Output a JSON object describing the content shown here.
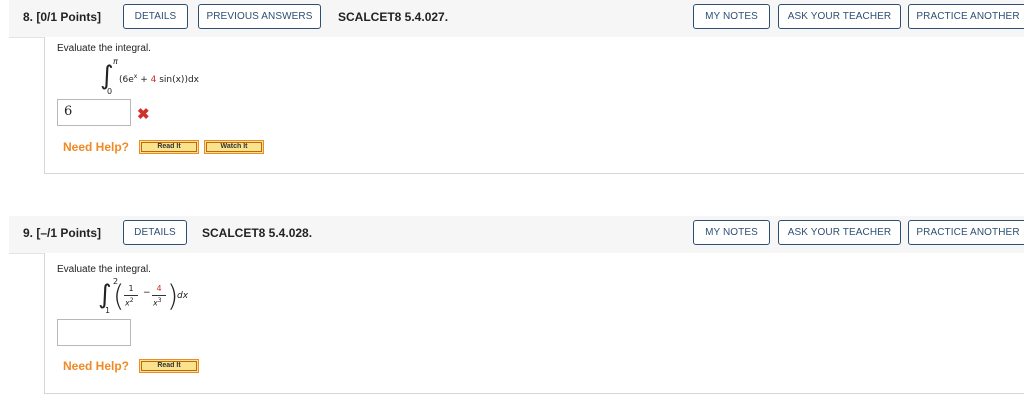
{
  "questions": [
    {
      "number_label": "8. [0/1 Points]",
      "buttons": {
        "details": "DETAILS",
        "previous_answers": "PREVIOUS ANSWERS"
      },
      "code": "SCALCET8 5.4.027.",
      "actions": {
        "my_notes": "MY NOTES",
        "ask_teacher": "ASK YOUR TEACHER",
        "practice": "PRACTICE ANOTHER"
      },
      "prompt": "Evaluate the integral.",
      "integral": {
        "upper": "π",
        "lower": "0",
        "term1_open": "(6e",
        "term1_exp": "x",
        "plus": " + ",
        "coef": "4",
        "term2": " sin(x))dx"
      },
      "answer_value": "6",
      "answer_status": "incorrect",
      "need_help": "Need Help?",
      "help_buttons": {
        "read": "Read It",
        "watch": "Watch It"
      }
    },
    {
      "number_label": "9. [–/1 Points]",
      "buttons": {
        "details": "DETAILS"
      },
      "code": "SCALCET8 5.4.028.",
      "actions": {
        "my_notes": "MY NOTES",
        "ask_teacher": "ASK YOUR TEACHER",
        "practice": "PRACTICE ANOTHER"
      },
      "prompt": "Evaluate the integral.",
      "integral": {
        "upper": "2",
        "lower": "1",
        "frac1_num": "1",
        "frac1_den": "x",
        "frac1_den_exp": "2",
        "minus": "−",
        "frac2_num": "4",
        "frac2_den": "x",
        "frac2_den_exp": "3",
        "dx": "dx"
      },
      "answer_value": "",
      "need_help": "Need Help?",
      "help_buttons": {
        "read": "Read It"
      }
    }
  ]
}
